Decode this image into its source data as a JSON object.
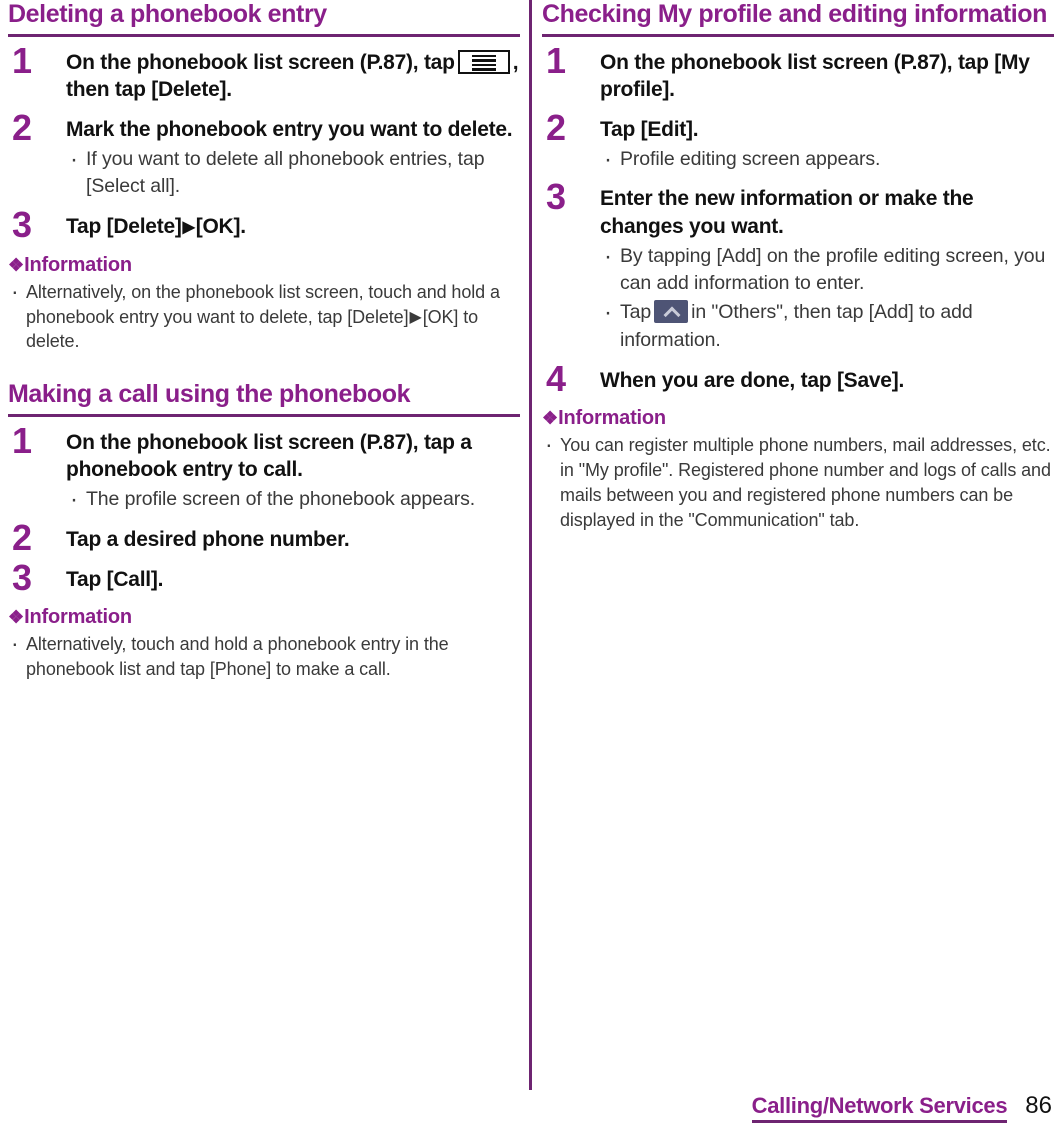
{
  "page": {
    "number": "86",
    "chapter": "Calling/Network Services"
  },
  "colors": {
    "heading_purple": "#8a1f8a",
    "rule_purple": "#6e2471",
    "body_text": "#3a3a3a",
    "caret_icon_bg": "#4e5475"
  },
  "left_column": {
    "sections": [
      {
        "title": "Deleting a phonebook entry",
        "steps": [
          {
            "number": "1",
            "text_before": "On the phonebook list screen (P.87), tap",
            "icon": "menu-icon",
            "text_after": ", then tap [Delete].",
            "subs": []
          },
          {
            "number": "2",
            "text": "Mark the phonebook entry you want to delete.",
            "subs": [
              "If you want to delete all phonebook entries, tap [Select all]."
            ]
          },
          {
            "number": "3",
            "text_before": "Tap [Delete]",
            "triangle": "▶",
            "text_after": "[OK].",
            "subs": []
          }
        ],
        "information": {
          "heading_icon": "❖",
          "heading": "Information",
          "items_parts": [
            {
              "before": "Alternatively, on the phonebook list screen, touch and hold a phonebook entry you want to delete, tap [Delete]",
              "triangle": "▶",
              "after": "[OK] to delete."
            }
          ]
        }
      },
      {
        "title": "Making a call using the phonebook",
        "steps": [
          {
            "number": "1",
            "text": "On the phonebook list screen (P.87), tap a phonebook entry to call.",
            "subs": [
              "The profile screen of the phonebook appears."
            ]
          },
          {
            "number": "2",
            "text": "Tap a desired phone number.",
            "subs": []
          },
          {
            "number": "3",
            "text": "Tap [Call].",
            "subs": []
          }
        ],
        "information": {
          "heading_icon": "❖",
          "heading": "Information",
          "items": [
            "Alternatively, touch and hold a phonebook entry in the phonebook list and tap [Phone] to make a call."
          ]
        }
      }
    ]
  },
  "right_column": {
    "sections": [
      {
        "title": "Checking My profile and editing information",
        "steps": [
          {
            "number": "1",
            "text": "On the phonebook list screen (P.87), tap [My profile].",
            "subs": []
          },
          {
            "number": "2",
            "text": "Tap [Edit].",
            "subs": [
              "Profile editing screen appears."
            ]
          },
          {
            "number": "3",
            "text": "Enter the new information or make the changes you want.",
            "subs": [
              "By tapping [Add] on the profile editing screen, you can add information to enter."
            ],
            "sub_with_icon": {
              "before": "Tap",
              "icon": "caret-up-icon",
              "after": "in \"Others\", then tap [Add] to add information."
            }
          },
          {
            "number": "4",
            "text": "When you are done, tap [Save].",
            "subs": []
          }
        ],
        "information": {
          "heading_icon": "❖",
          "heading": "Information",
          "items": [
            "You can register multiple phone numbers, mail addresses, etc. in \"My profile\". Registered phone number and logs of calls and mails between you and registered phone numbers can be displayed in the \"Communication\" tab."
          ]
        }
      }
    ]
  }
}
